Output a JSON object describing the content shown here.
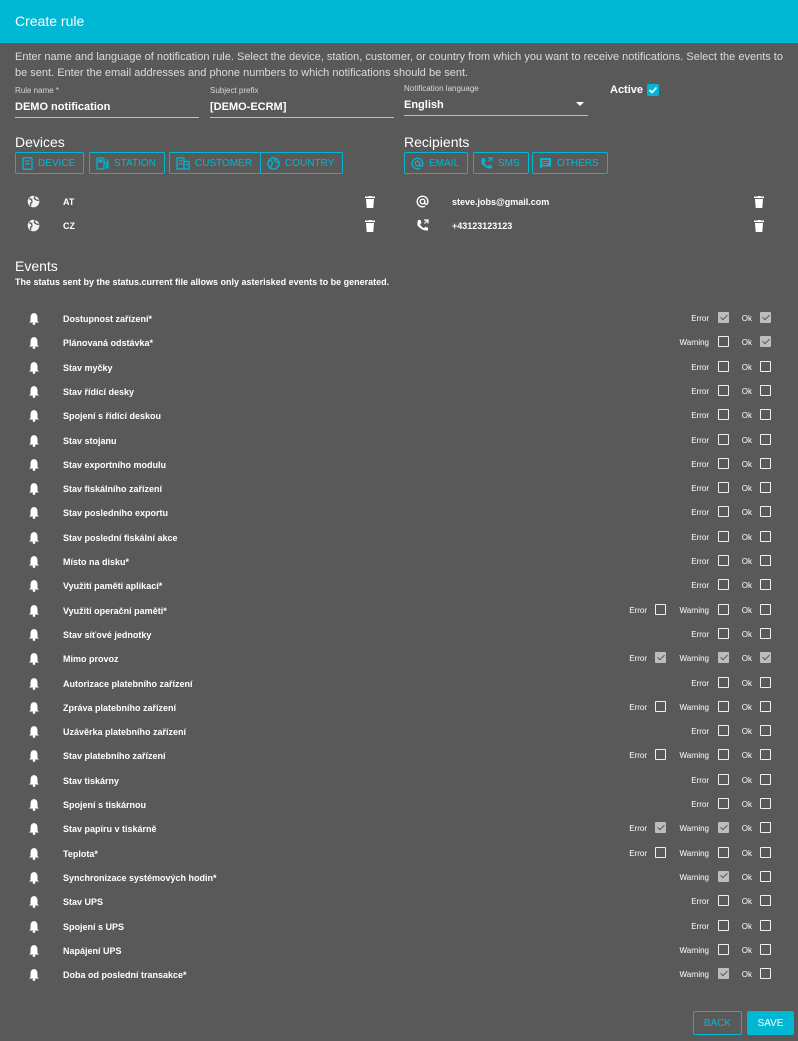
{
  "dialog": {
    "title": "Create rule"
  },
  "intro": "Enter name and language of notification rule. Select the device, station, customer, or country from which you want to receive notifications. Select the events to be sent. Enter the email addresses and phone numbers to which notifications should be sent.",
  "form": {
    "rule_name": {
      "label": "Rule name *",
      "value": "DEMO notification"
    },
    "subject_prefix": {
      "label": "Subject prefix",
      "value": "[DEMO-ECRM]"
    },
    "language": {
      "label": "Notification language",
      "value": "English"
    },
    "active": {
      "label": "Active",
      "checked": true
    }
  },
  "devices": {
    "title": "Devices",
    "chips": [
      "DEVICE",
      "STATION",
      "CUSTOMER",
      "COUNTRY"
    ],
    "items": [
      {
        "icon": "globe-icon",
        "label": "AT"
      },
      {
        "icon": "globe-icon",
        "label": "CZ"
      }
    ]
  },
  "recipients": {
    "title": "Recipients",
    "chips": [
      "EMAIL",
      "SMS",
      "OTHERS"
    ],
    "items": [
      {
        "icon": "at-icon",
        "label": "steve.jobs@gmail.com"
      },
      {
        "icon": "phone-icon",
        "label": "+43123123123"
      }
    ]
  },
  "events": {
    "title": "Events",
    "description": "The status sent by the status.current file allows only asterisked events to be generated.",
    "level_labels": {
      "error": "Error",
      "warning": "Warning",
      "ok": "Ok"
    },
    "items": [
      {
        "name": "Dostupnost zařízení*",
        "levels": [
          [
            "Error",
            true
          ],
          [
            "Ok",
            true
          ]
        ]
      },
      {
        "name": "Plánovaná odstávka*",
        "levels": [
          [
            "Warning",
            false
          ],
          [
            "Ok",
            true
          ]
        ]
      },
      {
        "name": "Stav myčky",
        "levels": [
          [
            "Error",
            false
          ],
          [
            "Ok",
            false
          ]
        ]
      },
      {
        "name": "Stav řídící desky",
        "levels": [
          [
            "Error",
            false
          ],
          [
            "Ok",
            false
          ]
        ]
      },
      {
        "name": "Spojení s řídící deskou",
        "levels": [
          [
            "Error",
            false
          ],
          [
            "Ok",
            false
          ]
        ]
      },
      {
        "name": "Stav stojanu",
        "levels": [
          [
            "Error",
            false
          ],
          [
            "Ok",
            false
          ]
        ]
      },
      {
        "name": "Stav exportního modulu",
        "levels": [
          [
            "Error",
            false
          ],
          [
            "Ok",
            false
          ]
        ]
      },
      {
        "name": "Stav fiskálního zařízení",
        "levels": [
          [
            "Error",
            false
          ],
          [
            "Ok",
            false
          ]
        ]
      },
      {
        "name": "Stav posledního exportu",
        "levels": [
          [
            "Error",
            false
          ],
          [
            "Ok",
            false
          ]
        ]
      },
      {
        "name": "Stav poslední fiskální akce",
        "levels": [
          [
            "Error",
            false
          ],
          [
            "Ok",
            false
          ]
        ]
      },
      {
        "name": "Místo na disku*",
        "levels": [
          [
            "Error",
            false
          ],
          [
            "Ok",
            false
          ]
        ]
      },
      {
        "name": "Využití paměti aplikací*",
        "levels": [
          [
            "Error",
            false
          ],
          [
            "Ok",
            false
          ]
        ]
      },
      {
        "name": "Využití operační paměti*",
        "levels": [
          [
            "Error",
            false
          ],
          [
            "Warning",
            false
          ],
          [
            "Ok",
            false
          ]
        ]
      },
      {
        "name": "Stav síťové jednotky",
        "levels": [
          [
            "Error",
            false
          ],
          [
            "Ok",
            false
          ]
        ]
      },
      {
        "name": "Mimo provoz",
        "levels": [
          [
            "Error",
            true
          ],
          [
            "Warning",
            true
          ],
          [
            "Ok",
            true
          ]
        ]
      },
      {
        "name": "Autorizace platebního zařízení",
        "levels": [
          [
            "Error",
            false
          ],
          [
            "Ok",
            false
          ]
        ]
      },
      {
        "name": "Zpráva platebního zařízení",
        "levels": [
          [
            "Error",
            false
          ],
          [
            "Warning",
            false
          ],
          [
            "Ok",
            false
          ]
        ]
      },
      {
        "name": "Uzávěrka platebního zařízení",
        "levels": [
          [
            "Error",
            false
          ],
          [
            "Ok",
            false
          ]
        ]
      },
      {
        "name": "Stav platebního zařízení",
        "levels": [
          [
            "Error",
            false
          ],
          [
            "Warning",
            false
          ],
          [
            "Ok",
            false
          ]
        ]
      },
      {
        "name": "Stav tiskárny",
        "levels": [
          [
            "Error",
            false
          ],
          [
            "Ok",
            false
          ]
        ]
      },
      {
        "name": "Spojení s tiskárnou",
        "levels": [
          [
            "Error",
            false
          ],
          [
            "Ok",
            false
          ]
        ]
      },
      {
        "name": "Stav papíru v tiskárně",
        "levels": [
          [
            "Error",
            true
          ],
          [
            "Warning",
            true
          ],
          [
            "Ok",
            false
          ]
        ]
      },
      {
        "name": "Teplota*",
        "levels": [
          [
            "Error",
            false
          ],
          [
            "Warning",
            false
          ],
          [
            "Ok",
            false
          ]
        ]
      },
      {
        "name": "Synchronizace systémových hodin*",
        "levels": [
          [
            "Warning",
            true
          ],
          [
            "Ok",
            false
          ]
        ]
      },
      {
        "name": "Stav UPS",
        "levels": [
          [
            "Error",
            false
          ],
          [
            "Ok",
            false
          ]
        ]
      },
      {
        "name": "Spojení s UPS",
        "levels": [
          [
            "Error",
            false
          ],
          [
            "Ok",
            false
          ]
        ]
      },
      {
        "name": "Napájení UPS",
        "levels": [
          [
            "Warning",
            false
          ],
          [
            "Ok",
            false
          ]
        ]
      },
      {
        "name": "Doba od poslední transakce*",
        "levels": [
          [
            "Warning",
            true
          ],
          [
            "Ok",
            false
          ]
        ]
      }
    ]
  },
  "footer": {
    "back_label": "BACK",
    "save_label": "SAVE"
  },
  "colors": {
    "accent": "#00b8d4",
    "background": "#595959"
  }
}
